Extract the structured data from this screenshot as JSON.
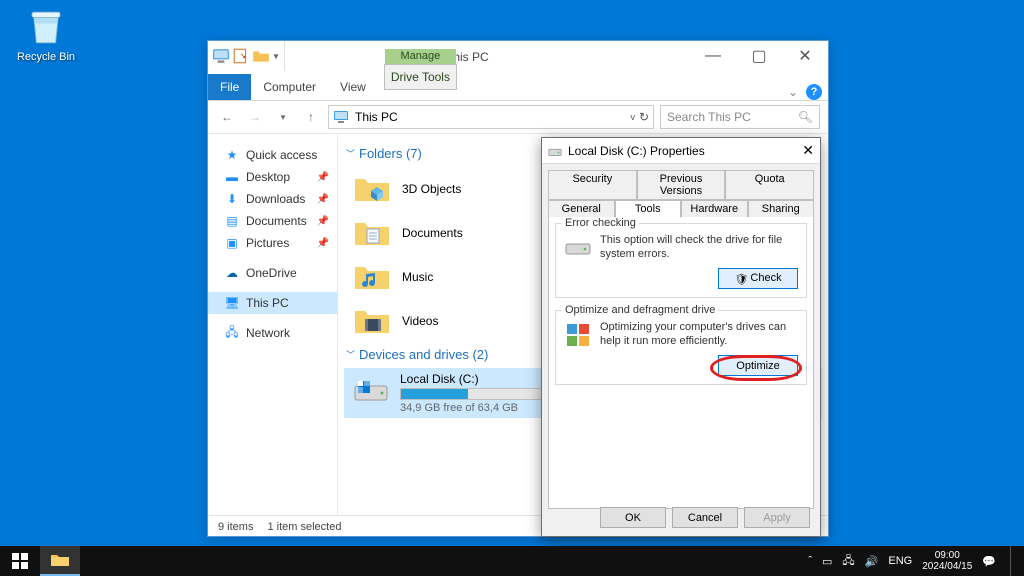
{
  "desktop": {
    "recycle_bin": "Recycle Bin"
  },
  "explorer": {
    "title": "This PC",
    "ribbon": {
      "file": "File",
      "computer": "Computer",
      "view": "View",
      "contextual_head": "Manage",
      "contextual_tab": "Drive Tools"
    },
    "address": {
      "location": "This PC"
    },
    "search": {
      "placeholder": "Search This PC"
    },
    "nav": {
      "quick_access": "Quick access",
      "desktop": "Desktop",
      "downloads": "Downloads",
      "documents": "Documents",
      "pictures": "Pictures",
      "onedrive": "OneDrive",
      "this_pc": "This PC",
      "network": "Network"
    },
    "sections": {
      "folders_head": "Folders (7)",
      "devices_head": "Devices and drives (2)"
    },
    "folders": {
      "objects3d": "3D Objects",
      "documents": "Documents",
      "music": "Music",
      "videos": "Videos"
    },
    "drive": {
      "name": "Local Disk (C:)",
      "free_text": "34,9 GB free of 63,4 GB",
      "fill_pct": 45
    },
    "status": {
      "items": "9 items",
      "selected": "1 item selected"
    }
  },
  "props": {
    "title": "Local Disk (C:) Properties",
    "tabs": {
      "security": "Security",
      "previous": "Previous Versions",
      "quota": "Quota",
      "general": "General",
      "tools": "Tools",
      "hardware": "Hardware",
      "sharing": "Sharing"
    },
    "error_check": {
      "legend": "Error checking",
      "text": "This option will check the drive for file system errors.",
      "button": "Check"
    },
    "optimize": {
      "legend": "Optimize and defragment drive",
      "text": "Optimizing your computer's drives can help it run more efficiently.",
      "button": "Optimize"
    },
    "buttons": {
      "ok": "OK",
      "cancel": "Cancel",
      "apply": "Apply"
    }
  },
  "taskbar": {
    "lang": "ENG",
    "time": "09:00",
    "date": "2024/04/15"
  }
}
